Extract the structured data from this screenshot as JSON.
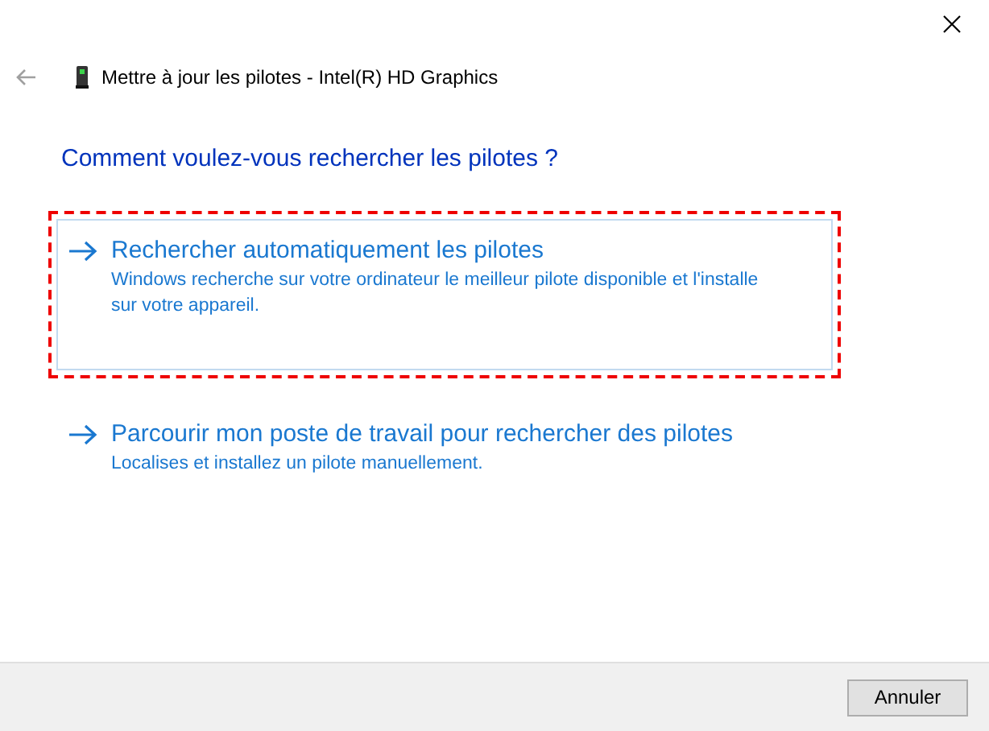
{
  "window": {
    "title": "Mettre à jour les pilotes - Intel(R) HD Graphics"
  },
  "heading": "Comment voulez-vous rechercher les pilotes ?",
  "options": [
    {
      "title": "Rechercher automatiquement les pilotes",
      "description": "Windows recherche sur votre ordinateur le meilleur pilote disponible et l'installe sur votre appareil.",
      "focused": true,
      "highlighted": true
    },
    {
      "title": "Parcourir mon poste de travail pour rechercher des pilotes",
      "description": "Localises et installez un pilote manuellement.",
      "focused": false,
      "highlighted": false
    }
  ],
  "buttons": [
    "Annuler"
  ]
}
